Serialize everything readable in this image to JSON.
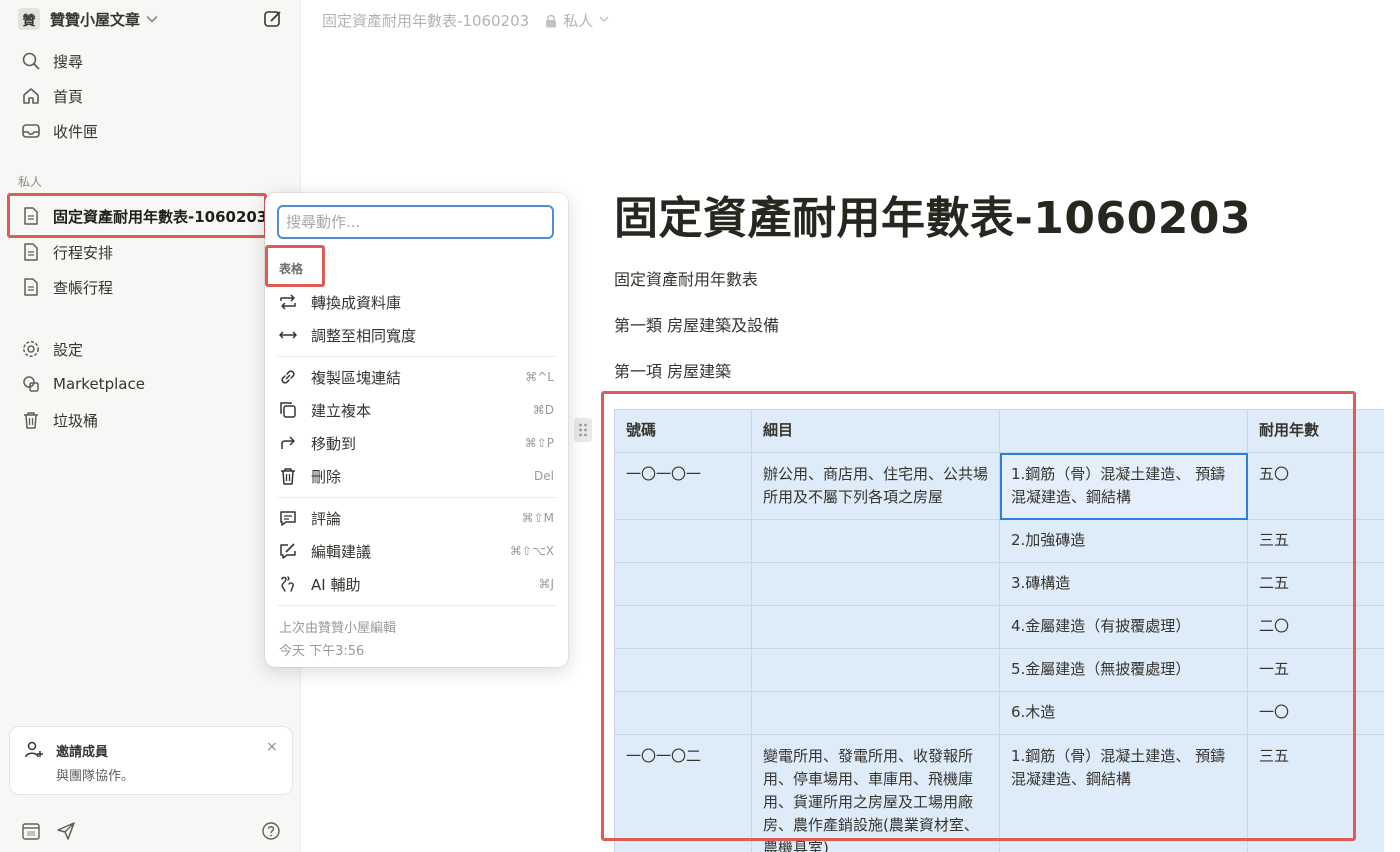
{
  "workspace": {
    "badge": "贊",
    "name": "贊贊小屋文章"
  },
  "nav": [
    {
      "label": "搜尋",
      "icon": "search-icon"
    },
    {
      "label": "首頁",
      "icon": "home-icon"
    },
    {
      "label": "收件匣",
      "icon": "inbox-icon"
    }
  ],
  "private_section": "私人",
  "pages": [
    {
      "label": "固定資產耐用年數表-1060203",
      "icon": "page-icon"
    },
    {
      "label": "行程安排",
      "icon": "page-icon"
    },
    {
      "label": "查帳行程",
      "icon": "page-icon"
    }
  ],
  "utility": [
    {
      "label": "設定",
      "icon": "gear-icon"
    },
    {
      "label": "Marketplace",
      "icon": "marketplace-icon"
    },
    {
      "label": "垃圾桶",
      "icon": "trash-icon"
    }
  ],
  "invite": {
    "title": "邀請成員",
    "subtitle": "與團隊協作。",
    "close": "×"
  },
  "breadcrumb": {
    "title": "固定資產耐用年數表-1060203",
    "privacy": "私人"
  },
  "page": {
    "title": "固定資產耐用年數表-1060203",
    "paragraphs": [
      "固定資產耐用年數表",
      "第一類 房屋建築及設備",
      "第一項 房屋建築"
    ]
  },
  "table": {
    "headers": [
      "號碼",
      "細目",
      "",
      "耐用年數"
    ],
    "rows": [
      [
        "一〇一〇一",
        "辦公用、商店用、住宅用、公共場所用及不屬下列各項之房屋",
        "1.鋼筋（骨）混凝土建造、 預鑄混凝建造、鋼結構",
        "五〇"
      ],
      [
        "",
        "",
        "2.加強磚造",
        "三五"
      ],
      [
        "",
        "",
        "3.磚構造",
        "二五"
      ],
      [
        "",
        "",
        "4.金屬建造（有披覆處理）",
        "二〇"
      ],
      [
        "",
        "",
        "5.金屬建造（無披覆處理）",
        "一五"
      ],
      [
        "",
        "",
        "6.木造",
        "一〇"
      ],
      [
        "一〇一〇二",
        "變電所用、發電所用、收發報所用、停車場用、車庫用、飛機庫用、貨運所用之房屋及工場用廠房、農作產銷設施(農業資材室、農機具室)",
        "1.鋼筋（骨）混凝土建造、 預鑄混凝建造、鋼結構",
        "三五"
      ]
    ]
  },
  "menu": {
    "search_placeholder": "搜尋動作...",
    "section": "表格",
    "items": [
      {
        "label": "轉換成資料庫",
        "shortcut": "",
        "icon": "convert-icon"
      },
      {
        "label": "調整至相同寬度",
        "shortcut": "",
        "icon": "resize-width-icon"
      },
      {
        "label": "複製區塊連結",
        "shortcut": "⌘^L",
        "icon": "link-icon"
      },
      {
        "label": "建立複本",
        "shortcut": "⌘D",
        "icon": "duplicate-icon"
      },
      {
        "label": "移動到",
        "shortcut": "⌘⇧P",
        "icon": "move-arrow-icon"
      },
      {
        "label": "刪除",
        "shortcut": "Del",
        "icon": "trash-icon"
      },
      {
        "label": "評論",
        "shortcut": "⌘⇧M",
        "icon": "comment-icon"
      },
      {
        "label": "編輯建議",
        "shortcut": "⌘⇧⌥X",
        "icon": "suggest-edit-icon"
      },
      {
        "label": "AI 輔助",
        "shortcut": "⌘J",
        "icon": "ai-icon"
      }
    ],
    "footer_line1": "上次由贊贊小屋編輯",
    "footer_line2": "今天 下午3:56"
  },
  "colors": {
    "highlight": "#e05b55",
    "table_bg": "#deebf9",
    "focus": "#4a90d9"
  }
}
